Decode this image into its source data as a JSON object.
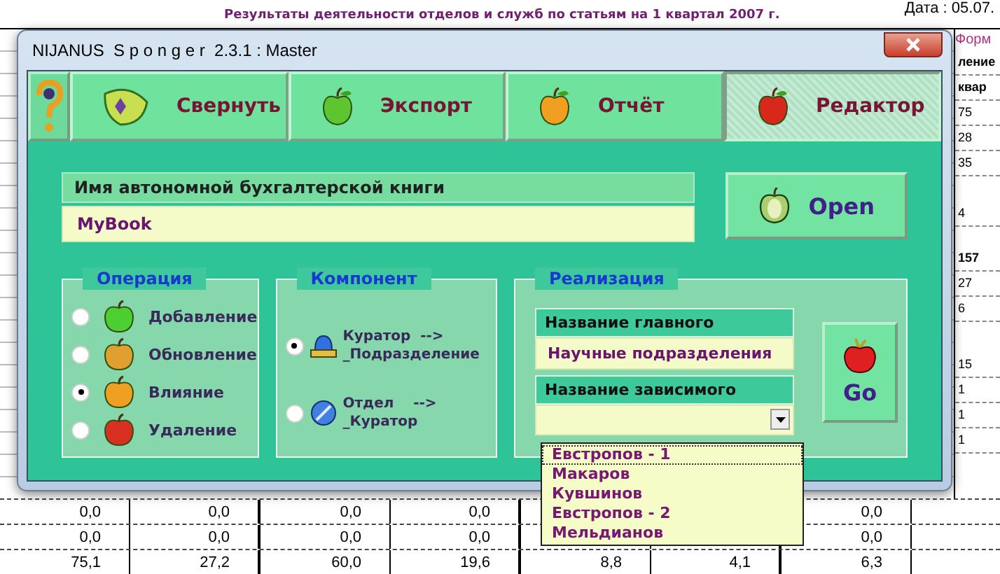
{
  "sheet": {
    "date": "Дата : 05.07.",
    "title": "Результаты деятельности отделов и служб по статьям на 1 квартал 2007 г.",
    "form": "Форм",
    "right_column": [
      "ление",
      "квар",
      "75",
      "28",
      "35",
      "4",
      "157",
      "27",
      "6",
      "15",
      "1",
      "1",
      "1"
    ],
    "rows": [
      [
        "0,0",
        "0,0",
        "0,0",
        "0,0",
        null,
        null,
        "0,0"
      ],
      [
        "0,0",
        "0,0",
        "0,0",
        "0,0",
        null,
        null,
        "0,0"
      ],
      [
        "75,1",
        "27,2",
        "60,0",
        "19,6",
        "8,8",
        "4,1",
        "6,3"
      ]
    ]
  },
  "window": {
    "title": "NIJANUS  S p o n g e r  2.3.1 : Master"
  },
  "tabs": [
    {
      "label": "Свернуть",
      "selected": false
    },
    {
      "label": "Экспорт",
      "selected": false
    },
    {
      "label": "Отчёт",
      "selected": false
    },
    {
      "label": "Редактор",
      "selected": true
    }
  ],
  "book": {
    "label": "Имя автономной бухгалтерской книги",
    "value": "MyBook"
  },
  "open_button": "Open",
  "operation": {
    "legend": "Операция",
    "options": [
      {
        "label": "Добавление",
        "selected": false
      },
      {
        "label": "Обновление",
        "selected": false
      },
      {
        "label": "Влияние",
        "selected": true
      },
      {
        "label": "Удаление",
        "selected": false
      }
    ]
  },
  "component": {
    "legend": "Компонент",
    "options": [
      {
        "label": "Куратор  -->\n_Подразделение",
        "selected": true
      },
      {
        "label": "Отдел    -->\n_Куратор",
        "selected": false
      }
    ]
  },
  "realization": {
    "legend": "Реализация",
    "main_label": "Название главного",
    "main_value": "Научные подразделения",
    "dependent_label": "Название зависимого",
    "dropdown_items": [
      {
        "label": "Евстропов - 1",
        "selected": true
      },
      {
        "label": "Макаров",
        "selected": false
      },
      {
        "label": "Кувшинов",
        "selected": false
      },
      {
        "label": "Евстропов - 2",
        "selected": false
      },
      {
        "label": "Мельдианов",
        "selected": false
      }
    ]
  },
  "go_button": "Go"
}
